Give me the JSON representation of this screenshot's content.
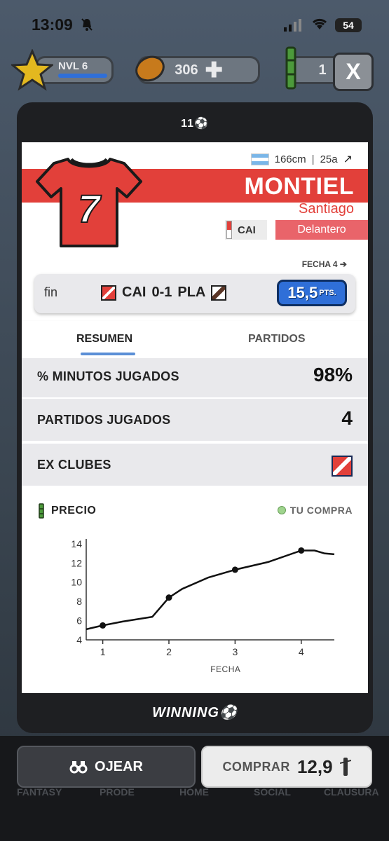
{
  "status": {
    "time": "13:09",
    "battery": "54"
  },
  "hud": {
    "level": "NVL 6",
    "coins": "306",
    "bamboo": "1"
  },
  "close_label": "X",
  "modal": {
    "logo": "11⚽",
    "footer_logo": "WINNING⚽"
  },
  "player": {
    "height": "166cm",
    "age": "25a",
    "last_name": "MONTIEL",
    "first_name": "Santiago",
    "number": "7",
    "club": "CAI",
    "position": "Delantero"
  },
  "match": {
    "fecha_link": "FECHA 4 ➔",
    "status": "fin",
    "home": "CAI",
    "score": "0-1",
    "away": "PLA",
    "points": "15,5",
    "points_suffix": "PTS."
  },
  "tabs": {
    "resumen": "RESUMEN",
    "partidos": "PARTIDOS"
  },
  "stats": {
    "minutes_label": "% MINUTOS JUGADOS",
    "minutes_value": "98%",
    "played_label": "PARTIDOS JUGADOS",
    "played_value": "4",
    "exclubs_label": "EX CLUBES"
  },
  "price": {
    "title": "PRECIO",
    "legend": "TU COMPRA"
  },
  "chart_data": {
    "type": "line",
    "xlabel": "FECHA",
    "ylabel": "",
    "x_ticks": [
      1,
      2,
      3,
      4
    ],
    "y_ticks": [
      4,
      6,
      8,
      10,
      12,
      14
    ],
    "xlim": [
      0.75,
      4.5
    ],
    "ylim": [
      4,
      14.5
    ],
    "line": [
      [
        0.75,
        5.1
      ],
      [
        1,
        5.5
      ],
      [
        1.3,
        5.9
      ],
      [
        1.75,
        6.4
      ],
      [
        2,
        8.4
      ],
      [
        2.2,
        9.3
      ],
      [
        2.6,
        10.5
      ],
      [
        3,
        11.3
      ],
      [
        3.5,
        12.1
      ],
      [
        4,
        13.3
      ],
      [
        4.2,
        13.3
      ],
      [
        4.35,
        13.0
      ],
      [
        4.5,
        12.9
      ]
    ],
    "markers": [
      [
        1,
        5.5
      ],
      [
        2,
        8.4
      ],
      [
        3,
        11.3
      ],
      [
        4,
        13.3
      ]
    ]
  },
  "actions": {
    "ojear": "OJEAR",
    "comprar": "COMPRAR",
    "price": "12,9"
  },
  "nav": [
    "FANTASY",
    "PRODE",
    "HOME",
    "SOCIAL",
    "CLAUSURA"
  ]
}
